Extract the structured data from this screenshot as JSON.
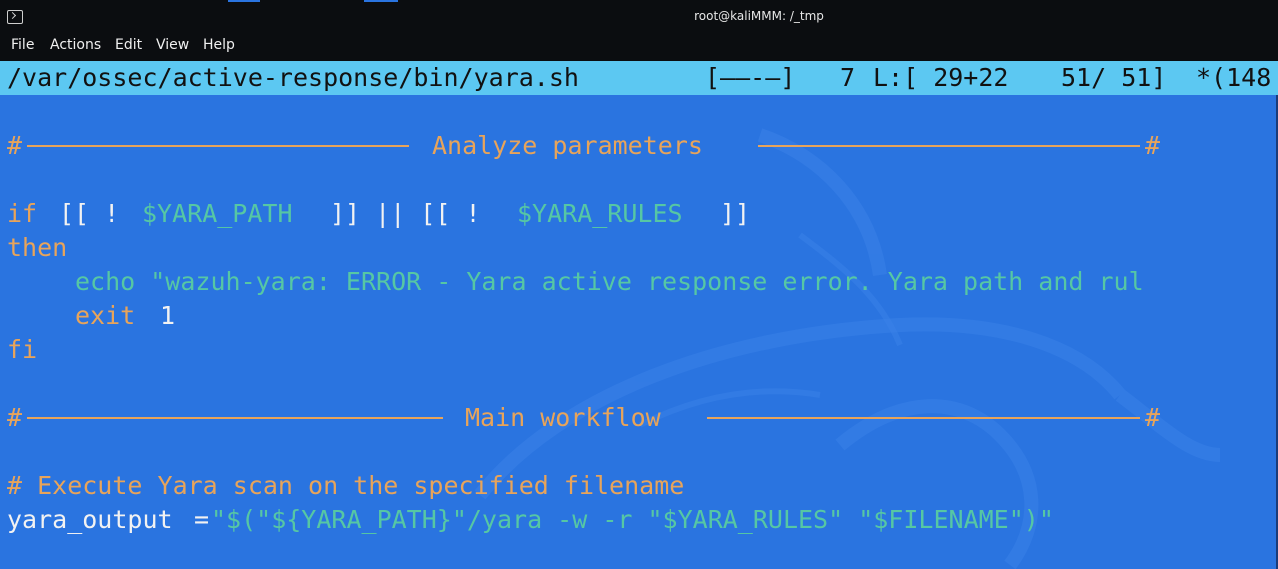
{
  "window": {
    "title": "root@kaliMMM: /_tmp"
  },
  "menu": {
    "items": [
      "File",
      "Actions",
      "Edit",
      "View",
      "Help"
    ]
  },
  "status": {
    "path": "/var/ossec/active-response/bin/yara.sh",
    "mode": "[——-—]",
    "col": "7",
    "pos": "L:[ 29+22",
    "lines": "51/ 51]",
    "chars": "*(148"
  },
  "code": {
    "section1_title": "Analyze parameters",
    "if_kw": "if",
    "if_open1": "[[ !",
    "var_path": "$YARA_PATH",
    "if_mid": "]] || [[ !",
    "var_rules": "$YARA_RULES",
    "if_close": "]]",
    "then_kw": "then",
    "echo_line": "echo \"wazuh-yara: ERROR - Yara active response error. Yara path and rul",
    "exit_kw": "exit",
    "exit_val": "1",
    "fi_kw": "fi",
    "section2_title": "Main workflow",
    "comment": "# Execute Yara scan on the specified filename",
    "assign_var": "yara_output",
    "assign_eq": "=",
    "assign_val": "\"$(\"${YARA_PATH}\"/yara -w -r \"$YARA_RULES\" \"$FILENAME\")\""
  },
  "colors": {
    "background": "#2a74e0",
    "statusbar": "#5cc8f2",
    "keyword": "#e8a45a",
    "string": "#56c7a4",
    "text": "#f2f2f2"
  }
}
